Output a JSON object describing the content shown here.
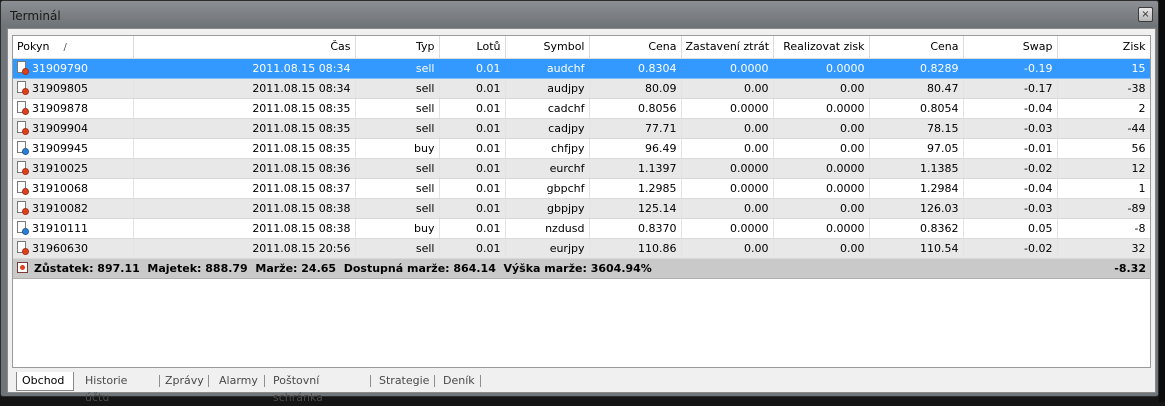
{
  "window": {
    "title": "Terminál",
    "close_glyph": "×"
  },
  "table": {
    "columns": [
      "Pokyn",
      "Čas",
      "Typ",
      "Lotů",
      "Symbol",
      "Cena",
      "Zastavení ztrát",
      "Realizovat zisk",
      "Cena",
      "Swap",
      "Zisk"
    ],
    "sort_indicator": "/",
    "rows": [
      {
        "id": "31909790",
        "time": "2011.08.15 08:34",
        "type": "sell",
        "lots": "0.01",
        "symbol": "audchf",
        "price": "0.8304",
        "sl": "0.0000",
        "tp": "0.0000",
        "cur_price": "0.8289",
        "swap": "-0.19",
        "profit": "15",
        "selected": true
      },
      {
        "id": "31909805",
        "time": "2011.08.15 08:34",
        "type": "sell",
        "lots": "0.01",
        "symbol": "audjpy",
        "price": "80.09",
        "sl": "0.00",
        "tp": "0.00",
        "cur_price": "80.47",
        "swap": "-0.17",
        "profit": "-38"
      },
      {
        "id": "31909878",
        "time": "2011.08.15 08:35",
        "type": "sell",
        "lots": "0.01",
        "symbol": "cadchf",
        "price": "0.8056",
        "sl": "0.0000",
        "tp": "0.0000",
        "cur_price": "0.8054",
        "swap": "-0.04",
        "profit": "2"
      },
      {
        "id": "31909904",
        "time": "2011.08.15 08:35",
        "type": "sell",
        "lots": "0.01",
        "symbol": "cadjpy",
        "price": "77.71",
        "sl": "0.00",
        "tp": "0.00",
        "cur_price": "78.15",
        "swap": "-0.03",
        "profit": "-44"
      },
      {
        "id": "31909945",
        "time": "2011.08.15 08:35",
        "type": "buy",
        "lots": "0.01",
        "symbol": "chfjpy",
        "price": "96.49",
        "sl": "0.00",
        "tp": "0.00",
        "cur_price": "97.05",
        "swap": "-0.01",
        "profit": "56"
      },
      {
        "id": "31910025",
        "time": "2011.08.15 08:36",
        "type": "sell",
        "lots": "0.01",
        "symbol": "eurchf",
        "price": "1.1397",
        "sl": "0.0000",
        "tp": "0.0000",
        "cur_price": "1.1385",
        "swap": "-0.02",
        "profit": "12"
      },
      {
        "id": "31910068",
        "time": "2011.08.15 08:37",
        "type": "sell",
        "lots": "0.01",
        "symbol": "gbpchf",
        "price": "1.2985",
        "sl": "0.0000",
        "tp": "0.0000",
        "cur_price": "1.2984",
        "swap": "-0.04",
        "profit": "1"
      },
      {
        "id": "31910082",
        "time": "2011.08.15 08:38",
        "type": "sell",
        "lots": "0.01",
        "symbol": "gbpjpy",
        "price": "125.14",
        "sl": "0.00",
        "tp": "0.00",
        "cur_price": "126.03",
        "swap": "-0.03",
        "profit": "-89"
      },
      {
        "id": "31910111",
        "time": "2011.08.15 08:38",
        "type": "buy",
        "lots": "0.01",
        "symbol": "nzdusd",
        "price": "0.8370",
        "sl": "0.0000",
        "tp": "0.0000",
        "cur_price": "0.8362",
        "swap": "0.05",
        "profit": "-8"
      },
      {
        "id": "31960630",
        "time": "2011.08.15 20:56",
        "type": "sell",
        "lots": "0.01",
        "symbol": "eurjpy",
        "price": "110.86",
        "sl": "0.00",
        "tp": "0.00",
        "cur_price": "110.54",
        "swap": "-0.02",
        "profit": "32"
      }
    ],
    "summary": {
      "text": "Zůstatek: 897.11  Majetek: 888.79  Marže: 24.65  Dostupná marže: 864.14  Výška marže: 3604.94%",
      "total_profit": "-8.32"
    }
  },
  "tabs": [
    "Obchod",
    "Historie účtu",
    "Zprávy",
    "Alarmy",
    "Poštovní schránka",
    "Strategie",
    "Deník"
  ],
  "active_tab": "Obchod",
  "colors": {
    "selection": "#3399ff",
    "sell_icon": "#e0401c",
    "buy_icon": "#2a7fd4",
    "alt_row": "#e8e8e8",
    "summary_row": "#c9c9c9"
  }
}
